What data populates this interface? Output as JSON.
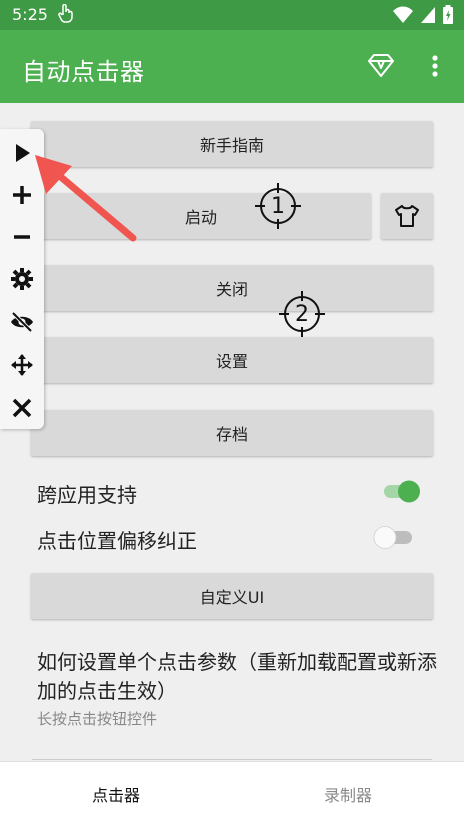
{
  "status_bar": {
    "time": "5:25"
  },
  "app_bar": {
    "title": "自动点击器"
  },
  "buttons": {
    "guide": "新手指南",
    "start": "启动",
    "close": "关闭",
    "settings": "设置",
    "archive": "存档",
    "custom_ui": "自定义UI"
  },
  "rows": {
    "cross_app": {
      "label": "跨应用支持",
      "enabled": true
    },
    "offset_fix": {
      "label": "点击位置偏移纠正",
      "enabled": false
    }
  },
  "help": {
    "title": "如何设置单个点击参数（重新加载配置或新添加的点击生效）",
    "subtitle": "长按点击按钮控件"
  },
  "targets": [
    {
      "number": "1"
    },
    {
      "number": "2"
    }
  ],
  "bottom_nav": {
    "tabs": [
      {
        "label": "点击器",
        "active": true
      },
      {
        "label": "录制器",
        "active": false
      }
    ]
  },
  "colors": {
    "primary": "#4caf50",
    "primary_dark": "#3e9a44",
    "accent_red": "#f0554f"
  }
}
